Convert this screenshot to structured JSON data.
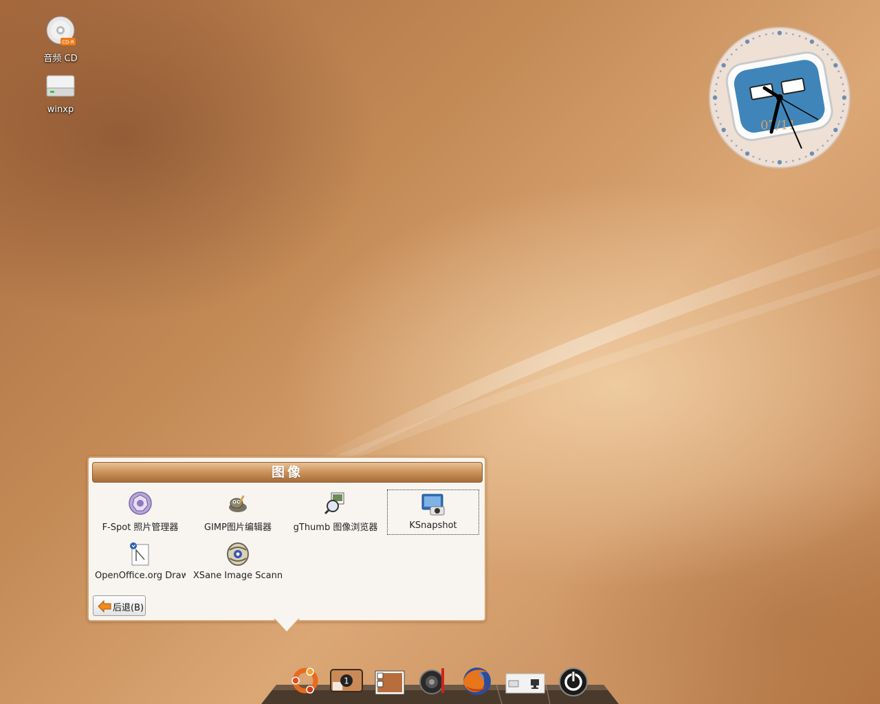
{
  "desktop": {
    "icons": [
      {
        "label": "音频 CD",
        "badge": "CD-R"
      },
      {
        "label": "winxp"
      }
    ]
  },
  "clock": {
    "date_text": "07/11"
  },
  "stack": {
    "title": "图像",
    "items": [
      {
        "name": "F-Spot 照片管理器",
        "icon": "f-spot-icon"
      },
      {
        "name": "GIMP图片编辑器",
        "icon": "gimp-icon"
      },
      {
        "name": "gThumb 图像浏览器",
        "icon": "gthumb-icon"
      },
      {
        "name": "KSnapshot",
        "icon": "ksnapshot-icon",
        "selected": true
      },
      {
        "name": "OpenOffice.org Draw",
        "icon": "openoffice-draw-icon"
      },
      {
        "name": "XSane Image Scann",
        "icon": "xsane-icon"
      }
    ],
    "back_button": "后退(B)"
  },
  "dock": {
    "items": [
      "ubuntu-menu",
      "workspace-switcher",
      "image-stack",
      "volume",
      "firefox",
      "system-tray",
      "power"
    ],
    "workspace_number": "1"
  }
}
